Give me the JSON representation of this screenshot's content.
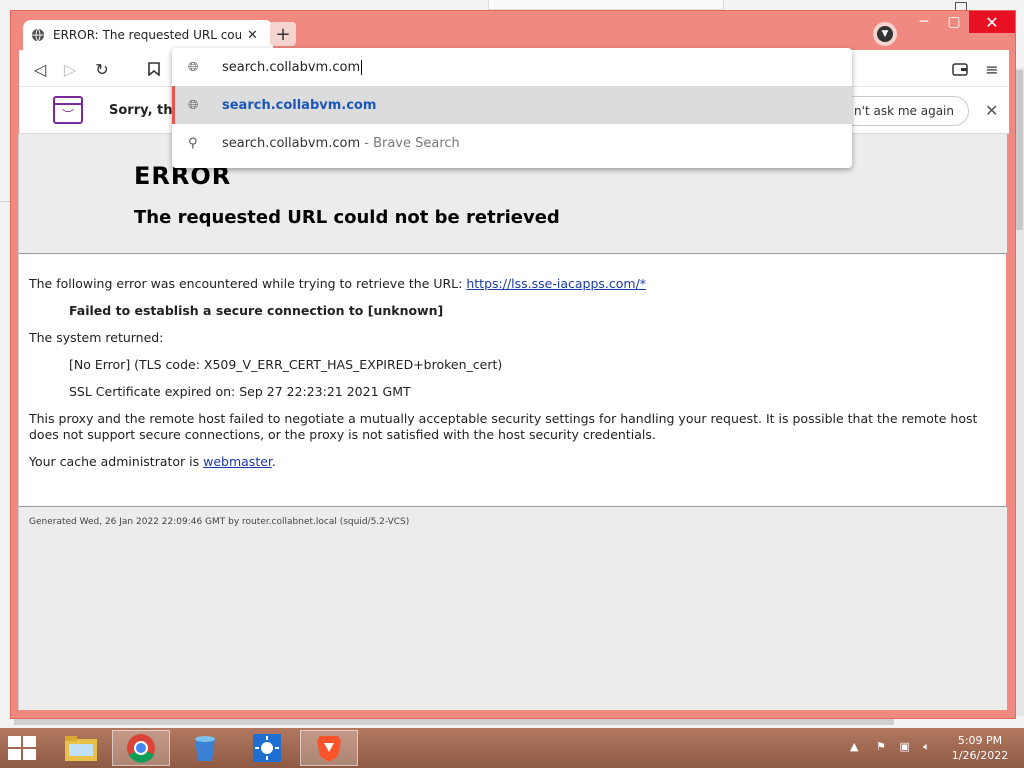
{
  "window": {
    "tab_title": "ERROR: The requested URL could",
    "new_tab_symbol": "+",
    "close_symbol": "✕"
  },
  "toolbar": {
    "back_icon": "◁",
    "forward_icon": "▷",
    "reload_icon": "↻",
    "bookmark_icon": "bookmark-icon",
    "wallet_icon": "wallet-icon",
    "menu_icon": "≡"
  },
  "omnibox": {
    "input_value": "search.collabvm.com",
    "suggestions": [
      {
        "text": "search.collabvm.com",
        "sub": ""
      },
      {
        "text": "search.collabvm.com",
        "sub": " - Brave Search"
      }
    ]
  },
  "infobar": {
    "text": "Sorry, that",
    "dont_ask_label": "n't ask me again",
    "close_symbol": "✕"
  },
  "page": {
    "h1": "ERROR",
    "h2": "The requested URL could not be retrieved",
    "intro": "The following error was encountered while trying to retrieve the URL: ",
    "url_link": "https://lss.sse-iacapps.com/*",
    "failure": "Failed to establish a secure connection to [unknown]",
    "system_returned": "The system returned:",
    "error_code": "[No Error] (TLS code: X509_V_ERR_CERT_HAS_EXPIRED+broken_cert)",
    "ssl_expired": "SSL Certificate expired on: Sep 27 22:23:21 2021 GMT",
    "explanation": "This proxy and the remote host failed to negotiate a mutually acceptable security settings for handling your request. It is possible that the remote host does not support secure connections, or the proxy is not satisfied with the host security credentials.",
    "admin_prefix": "Your cache administrator is ",
    "admin_link": "webmaster",
    "admin_suffix": ".",
    "generated": "Generated Wed, 26 Jan 2022 22:09:46 GMT by router.collabnet.local (squid/5.2-VCS)"
  },
  "taskbar": {
    "time": "5:09 PM",
    "date": "1/26/2022",
    "apps": [
      "file-explorer-icon",
      "chrome-icon",
      "recycle-bucket-icon",
      "weather-sun-icon",
      "brave-icon"
    ]
  },
  "colors": {
    "frame": "#f08a80",
    "taskbar": "#a06a50",
    "link": "#1a3aa8",
    "suggestion_highlight": "#1a57b8"
  }
}
